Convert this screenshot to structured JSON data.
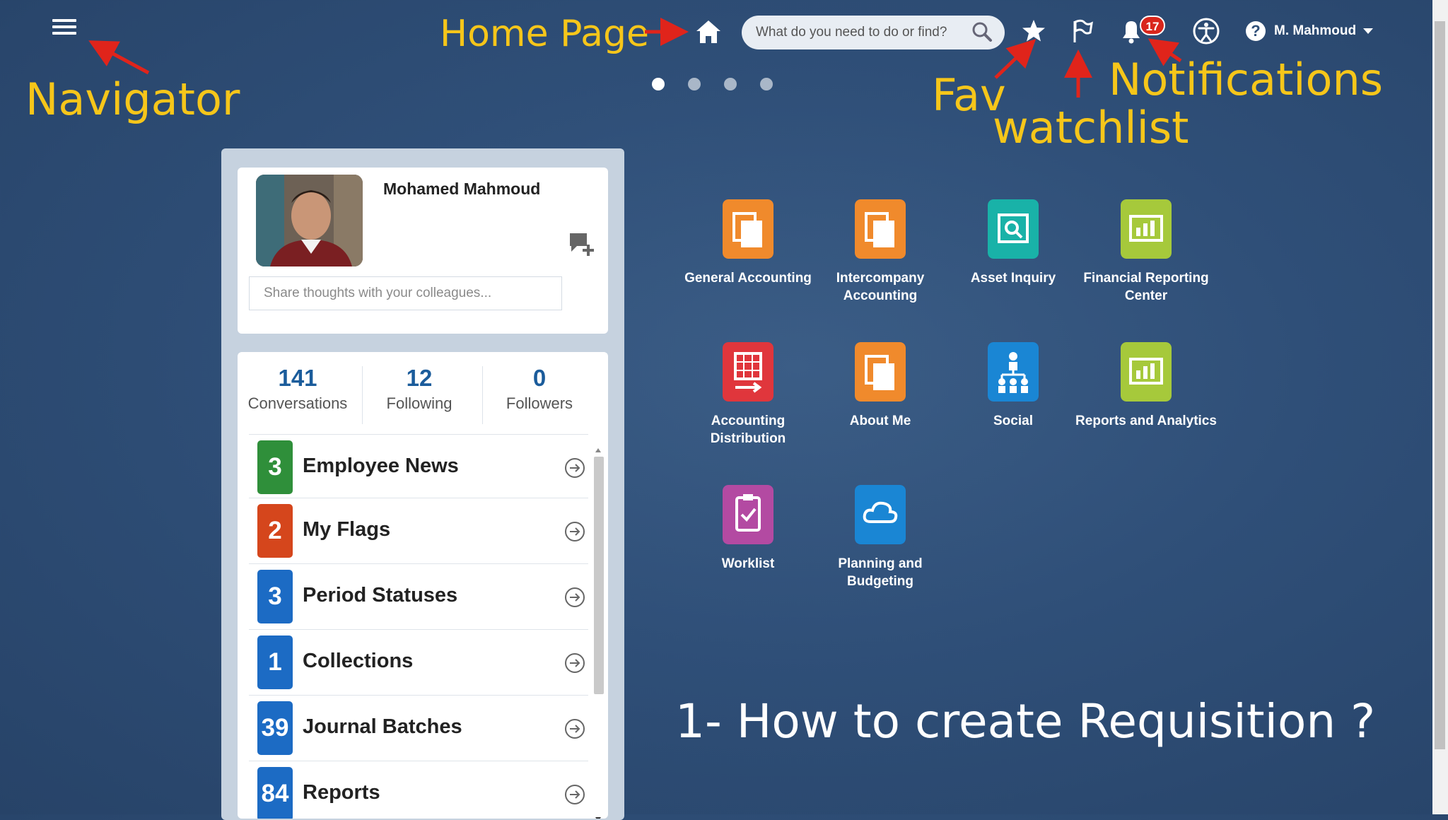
{
  "topbar": {
    "search_placeholder": "What do you need to do or find?",
    "notification_count": "17",
    "user_name": "M. Mahmoud",
    "help_glyph": "?",
    "page_dots_count": 4,
    "active_dot": 0
  },
  "annotations": {
    "navigator": "Navigator",
    "home_page": "Home Page",
    "fav": "Fav",
    "watchlist": "watchlist",
    "notifications": "Notifications",
    "arrow_color": "#e0241b",
    "text_color": "#f6c61a"
  },
  "overlay_title": "1- How to create Requisition ?",
  "profile": {
    "name": "Mohamed Mahmoud",
    "share_placeholder": "Share thoughts with your colleagues..."
  },
  "stats": [
    {
      "value": "141",
      "label": "Conversations"
    },
    {
      "value": "12",
      "label": "Following"
    },
    {
      "value": "0",
      "label": "Followers"
    }
  ],
  "worklist_items": [
    {
      "count": "3",
      "label": "Employee News",
      "color": "#2f8f3a"
    },
    {
      "count": "2",
      "label": "My Flags",
      "color": "#d5461c"
    },
    {
      "count": "3",
      "label": "Period Statuses",
      "color": "#1c6bc4"
    },
    {
      "count": "1",
      "label": "Collections",
      "color": "#1c6bc4"
    },
    {
      "count": "39",
      "label": "Journal Batches",
      "color": "#1c6bc4"
    },
    {
      "count": "84",
      "label": "Reports",
      "color": "#1c6bc4"
    }
  ],
  "apps": [
    {
      "label": "General Accounting",
      "icon": "documents-icon",
      "color": "#f08a2c"
    },
    {
      "label": "Intercompany Accounting",
      "icon": "documents-icon",
      "color": "#f08a2c"
    },
    {
      "label": "Asset Inquiry",
      "icon": "asset-search-icon",
      "color": "#19b2a8"
    },
    {
      "label": "Financial Reporting Center",
      "icon": "report-chart-icon",
      "color": "#a6c93b"
    },
    {
      "label": "Accounting Distribution",
      "icon": "ledger-arrow-icon",
      "color": "#e0363c"
    },
    {
      "label": "About Me",
      "icon": "documents-icon",
      "color": "#f08a2c"
    },
    {
      "label": "Social",
      "icon": "org-people-icon",
      "color": "#1a86d4"
    },
    {
      "label": "Reports and Analytics",
      "icon": "report-chart-icon",
      "color": "#a6c93b"
    },
    {
      "label": "Worklist",
      "icon": "clipboard-check-icon",
      "color": "#b34aa2"
    },
    {
      "label": "Planning and Budgeting",
      "icon": "cloud-icon",
      "color": "#1a86d4"
    }
  ]
}
